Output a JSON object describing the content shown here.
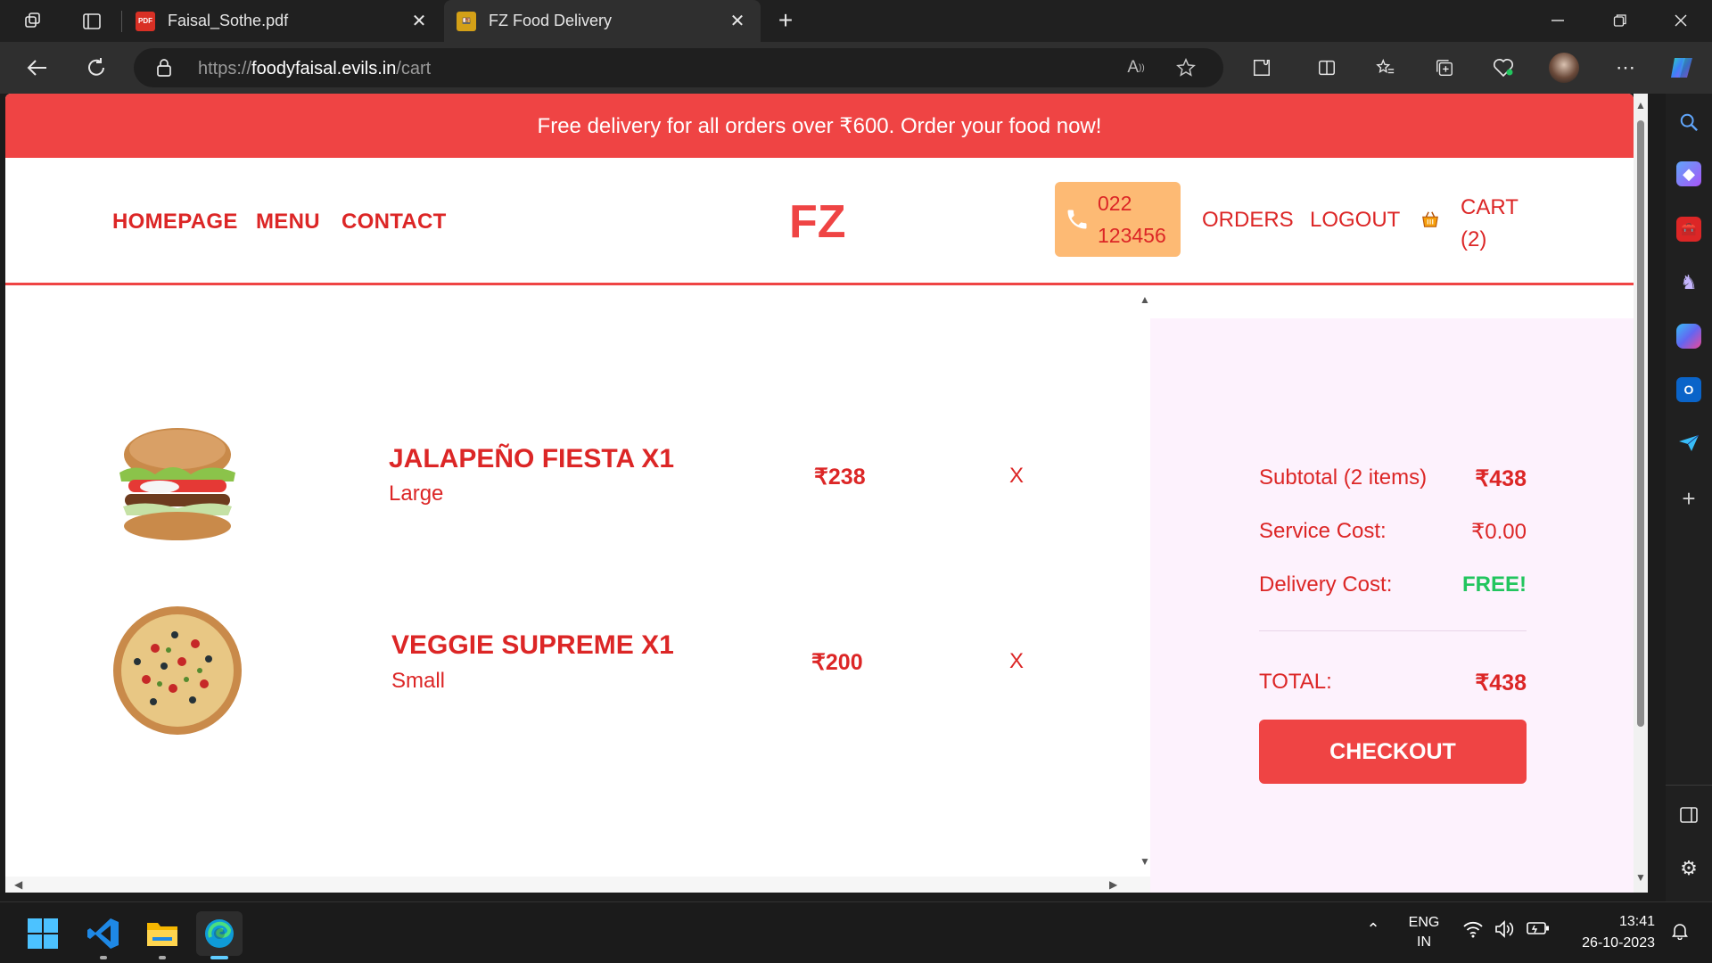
{
  "browser": {
    "tabs": [
      {
        "title": "Faisal_Sothe.pdf",
        "favicon": "pdf-icon",
        "active": false
      },
      {
        "title": "FZ Food Delivery",
        "favicon": "food-delivery-icon",
        "active": true
      }
    ],
    "url_scheme": "https://",
    "url_host": "foodyfaisal.evils.in",
    "url_path": "/cart"
  },
  "site": {
    "promo": "Free delivery for all orders over ₹600. Order your food now!",
    "nav": {
      "homepage": "HOMEPAGE",
      "menu": "MENU",
      "contact": "CONTACT",
      "logo": "FZ",
      "phone_line1": "022",
      "phone_line2": "123456",
      "orders": "ORDERS",
      "logout": "LOGOUT",
      "cart_line1": "CART",
      "cart_line2": "(2)"
    },
    "cart_items": [
      {
        "name": "JALAPEÑO FIESTA X1",
        "size": "Large",
        "price": "₹238",
        "remove": "X",
        "image": "burger-image"
      },
      {
        "name": "VEGGIE SUPREME X1",
        "size": "Small",
        "price": "₹200",
        "remove": "X",
        "image": "pizza-image"
      }
    ],
    "summary": {
      "subtotal_label": "Subtotal (2 items)",
      "subtotal_value": "₹438",
      "service_label": "Service Cost:",
      "service_value": "₹0.00",
      "delivery_label": "Delivery Cost:",
      "delivery_value": "FREE!",
      "total_label": "TOTAL:",
      "total_value": "₹438",
      "checkout": "CHECKOUT"
    },
    "colors": {
      "primary": "#ef4444",
      "text_red": "#dc2626",
      "phone_bg": "#fdba74",
      "summary_bg": "#fdf2fd",
      "free_green": "#22c55e"
    }
  },
  "taskbar": {
    "language_line1": "ENG",
    "language_line2": "IN",
    "time": "13:41",
    "date": "26-10-2023"
  }
}
